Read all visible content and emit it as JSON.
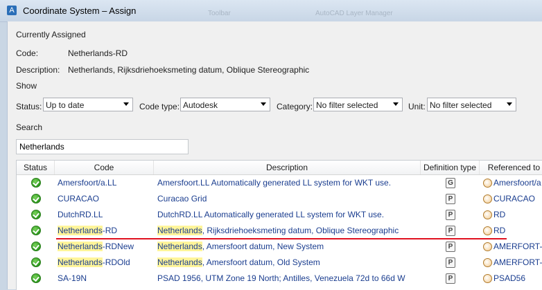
{
  "window": {
    "title": "Coordinate System – Assign",
    "bg_tab_1": "Toolbar",
    "bg_tab_2": "AutoCAD Layer Manager"
  },
  "assigned": {
    "section_label": "Currently Assigned",
    "code_label": "Code:",
    "code_value": "Netherlands-RD",
    "desc_label": "Description:",
    "desc_value": "Netherlands, Rijksdriehoeksmeting datum, Oblique Stereographic"
  },
  "show": {
    "section_label": "Show",
    "status_label": "Status:",
    "status_value": "Up to date",
    "codetype_label": "Code type:",
    "codetype_value": "Autodesk",
    "category_label": "Category:",
    "category_value": "No filter selected",
    "unit_label": "Unit:",
    "unit_value": "No filter selected"
  },
  "search": {
    "section_label": "Search",
    "value": "Netherlands"
  },
  "grid": {
    "columns": [
      "Status",
      "Code",
      "Description",
      "Definition type",
      "Referenced to"
    ],
    "rows": [
      {
        "code_hl": "",
        "code_rest": "Amersfoort/a.LL",
        "desc_hl": "",
        "desc_rest": "Amersfoort.LL Automatically generated LL system for WKT use.",
        "def": "G",
        "ref": "Amersfoort/a"
      },
      {
        "code_hl": "",
        "code_rest": "CURACAO",
        "desc_hl": "",
        "desc_rest": "Curacao Grid",
        "def": "P",
        "ref": "CURACAO"
      },
      {
        "code_hl": "",
        "code_rest": "DutchRD.LL",
        "desc_hl": "",
        "desc_rest": "DutchRD.LL Automatically generated LL system for WKT use.",
        "def": "P",
        "ref": "RD"
      },
      {
        "code_hl": "Netherlands",
        "code_rest": "-RD",
        "desc_hl": "Netherlands",
        "desc_rest": ", Rijksdriehoeksmeting datum, Oblique Stereographic",
        "def": "P",
        "ref": "RD"
      },
      {
        "code_hl": "Netherlands",
        "code_rest": "-RDNew",
        "desc_hl": "Netherlands",
        "desc_rest": ", Amersfoort datum, New System",
        "def": "P",
        "ref": "AMERFORT-"
      },
      {
        "code_hl": "Netherlands",
        "code_rest": "-RDOld",
        "desc_hl": "Netherlands",
        "desc_rest": ", Amersfoort datum, Old System",
        "def": "P",
        "ref": "AMERFORT-"
      },
      {
        "code_hl": "",
        "code_rest": "SA-19N",
        "desc_hl": "",
        "desc_rest": "PSAD 1956, UTM Zone 19 North; Antilles, Venezuela 72d to 66d W",
        "def": "P",
        "ref": "PSAD56"
      }
    ]
  },
  "colors": {
    "highlight": "#fff59a",
    "underline": "#e0101f",
    "link_text": "#1a3d8f"
  }
}
